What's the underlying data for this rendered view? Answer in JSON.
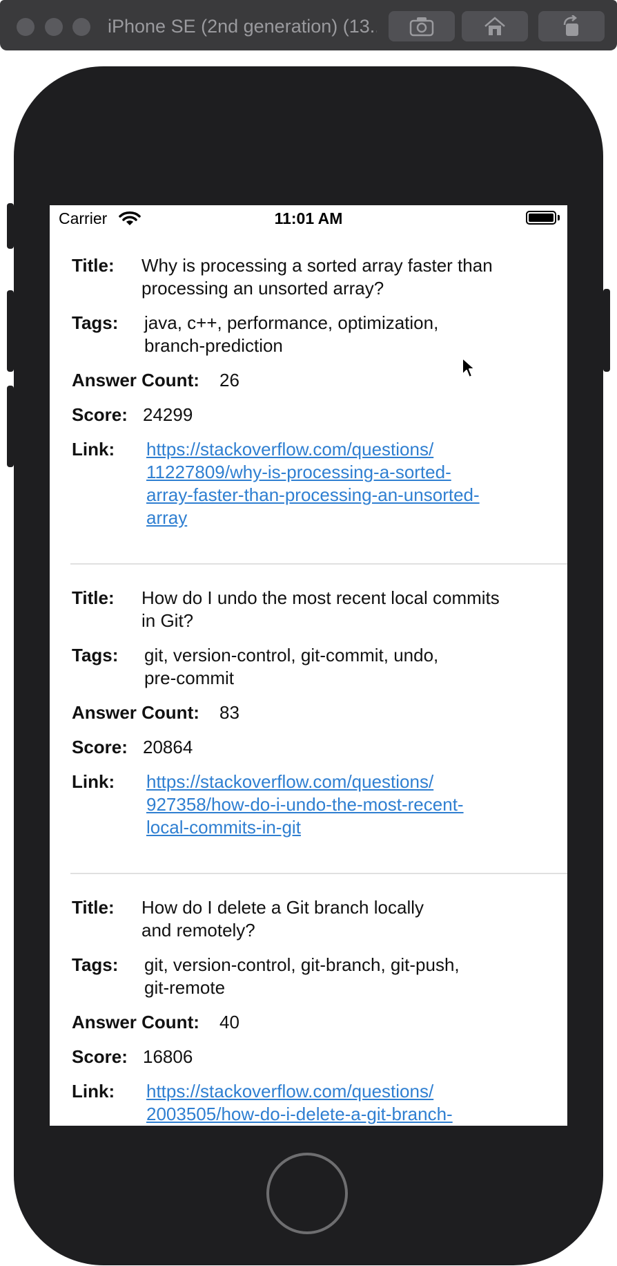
{
  "simulator": {
    "title": "iPhone SE (2nd generation) (13..."
  },
  "status_bar": {
    "carrier": "Carrier",
    "time": "11:01 AM"
  },
  "labels": {
    "title": "Title:",
    "tags": "Tags:",
    "answer_count": "Answer Count:",
    "score": "Score:",
    "link": "Link:"
  },
  "questions": [
    {
      "title": "Why is processing a sorted array faster than\nprocessing an unsorted array?",
      "tags": "java, c++, performance, optimization,\nbranch-prediction",
      "answer_count": "26",
      "score": "24299",
      "link": "https://stackoverflow.com/questions/\n11227809/why-is-processing-a-sorted-\narray-faster-than-processing-an-unsorted-\narray"
    },
    {
      "title": "How do I undo the most recent local commits\nin Git?",
      "tags": "git, version-control, git-commit, undo,\npre-commit",
      "answer_count": "83",
      "score": "20864",
      "link": "https://stackoverflow.com/questions/\n927358/how-do-i-undo-the-most-recent-\nlocal-commits-in-git"
    },
    {
      "title": "How do I delete a Git branch locally\nand remotely?",
      "tags": "git, version-control, git-branch, git-push,\ngit-remote",
      "answer_count": "40",
      "score": "16806",
      "link": "https://stackoverflow.com/questions/\n2003505/how-do-i-delete-a-git-branch-"
    }
  ]
}
